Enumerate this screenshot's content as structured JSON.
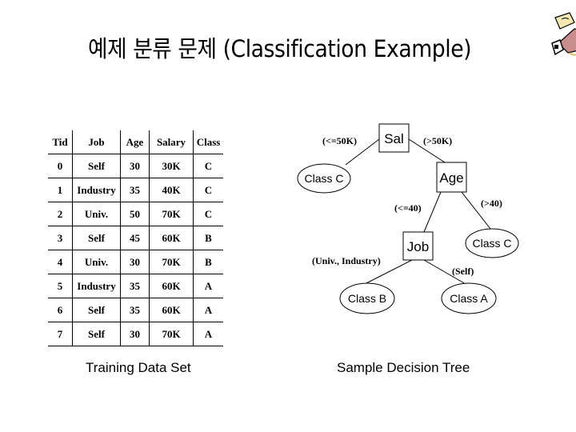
{
  "title": "예제 분류 문제 (Classification Example)",
  "clipart_icon": "person-writing-clipart",
  "training_table": {
    "caption": "Training Data Set",
    "columns": [
      "Tid",
      "Job",
      "Age",
      "Salary",
      "Class"
    ],
    "rows": [
      [
        "0",
        "Self",
        "30",
        "30K",
        "C"
      ],
      [
        "1",
        "Industry",
        "35",
        "40K",
        "C"
      ],
      [
        "2",
        "Univ.",
        "50",
        "70K",
        "C"
      ],
      [
        "3",
        "Self",
        "45",
        "60K",
        "B"
      ],
      [
        "4",
        "Univ.",
        "30",
        "70K",
        "B"
      ],
      [
        "5",
        "Industry",
        "35",
        "60K",
        "A"
      ],
      [
        "6",
        "Self",
        "35",
        "60K",
        "A"
      ],
      [
        "7",
        "Self",
        "30",
        "70K",
        "A"
      ]
    ]
  },
  "decision_tree": {
    "caption": "Sample Decision Tree",
    "nodes": {
      "sal": {
        "label": "Sal",
        "type": "test"
      },
      "class_c_1": {
        "label": "Class C",
        "type": "leaf"
      },
      "age": {
        "label": "Age",
        "type": "test"
      },
      "job": {
        "label": "Job",
        "type": "test"
      },
      "class_c_2": {
        "label": "Class C",
        "type": "leaf"
      },
      "class_b": {
        "label": "Class B",
        "type": "leaf"
      },
      "class_a": {
        "label": "Class A",
        "type": "leaf"
      }
    },
    "edges": [
      {
        "from": "sal",
        "to": "class_c_1",
        "label": "(<=50K)"
      },
      {
        "from": "sal",
        "to": "age",
        "label": "(>50K)"
      },
      {
        "from": "age",
        "to": "job",
        "label": "(<=40)"
      },
      {
        "from": "age",
        "to": "class_c_2",
        "label": "(>40)"
      },
      {
        "from": "job",
        "to": "class_b",
        "label": "(Univ., Industry)"
      },
      {
        "from": "job",
        "to": "class_a",
        "label": "(Self)"
      }
    ]
  }
}
